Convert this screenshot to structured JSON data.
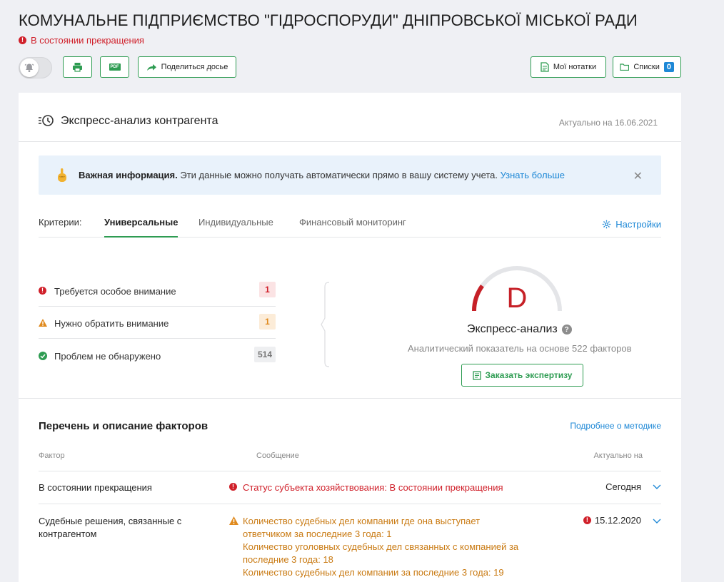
{
  "page": {
    "title": "КОМУНАЛЬНЕ ПІДПРИЄМСТВО \"ГІДРОСПОРУДИ\" ДНІПРОВСЬКОЇ МІСЬКОЇ РАДИ",
    "status": "В состоянии прекращения"
  },
  "toolbar": {
    "share_label": "Поделиться досье",
    "notes_label": "Мої нотатки",
    "lists_label": "Списки",
    "lists_count": "0",
    "pdf_glyph": "PDF"
  },
  "express": {
    "title": "Экспресс-анализ контрагента",
    "actual": "Актуально на 16.06.2021",
    "banner_bold": "Важная информация.",
    "banner_text": "Эти данные можно получать автоматически прямо в вашу систему учета.",
    "banner_link": "Узнать больше",
    "criteria_label": "Критерии:",
    "tabs": [
      "Универсальные",
      "Индивидуальные",
      "Финансовый мониторинг"
    ],
    "settings_label": "Настройки",
    "criteria": [
      {
        "label": "Требуется особое внимание",
        "count": "1"
      },
      {
        "label": "Нужно обратить внимание",
        "count": "1"
      },
      {
        "label": "Проблем не обнаружено",
        "count": "514"
      }
    ],
    "grade": "D",
    "grade_fraction": 0.2,
    "grade_title": "Экспресс-анализ",
    "grade_subtitle": "Аналитический показатель на основе 522 факторов",
    "order_label": "Заказать экспертизу"
  },
  "factors": {
    "title": "Перечень и описание факторов",
    "method_link": "Подробнее о методике",
    "headers": {
      "factor": "Фактор",
      "message": "Сообщение",
      "actual": "Актуально на"
    },
    "rows": [
      {
        "factor": "В состоянии прекращения",
        "messages": [
          "Статус субъекта хозяйствования: В состоянии прекращения"
        ],
        "date": "Сегодня"
      },
      {
        "factor": "Судебные решения, связанные с контрагентом",
        "messages": [
          "Количество судебных дел компании где она выступает ответчиком за последние 3 года: 1",
          "Количество уголовных судебных дел связанных с компанией за последние 3 года: 18",
          "Количество судебных дел компании за последние 3 года: 19"
        ],
        "date": "15.12.2020"
      }
    ]
  },
  "colors": {
    "brand_green": "#2e9c52",
    "danger_red": "#d0202a",
    "warning_orange": "#e08a1e",
    "link_blue": "#1e88d6"
  }
}
